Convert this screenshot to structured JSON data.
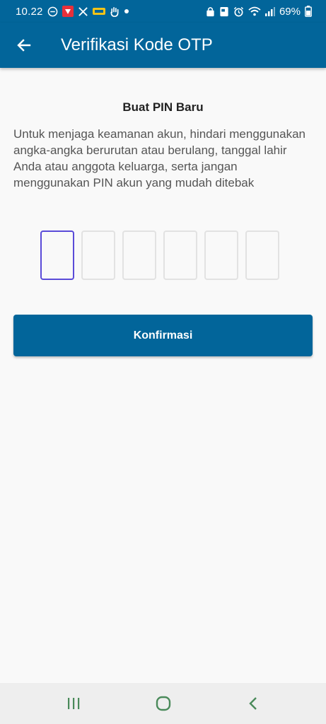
{
  "status_bar": {
    "time": "10.22",
    "battery": "69%",
    "icons": [
      "dnd-icon",
      "app-notification-icon",
      "x-icon",
      "app-icon",
      "hand-icon",
      "dot-icon",
      "lock-icon",
      "photo-icon",
      "alarm-icon",
      "wifi-icon",
      "signal-icon",
      "battery-icon"
    ]
  },
  "app_bar": {
    "title": "Verifikasi Kode OTP",
    "back_icon": "arrow-left-icon"
  },
  "main": {
    "heading": "Buat PIN Baru",
    "description": "Untuk menjaga keamanan akun, hindari menggunakan angka-angka berurutan atau berulang, tanggal lahir Anda atau anggota keluarga, serta jangan menggunakan PIN akun yang mudah ditebak",
    "pin_length": 6,
    "confirm_label": "Konfirmasi"
  },
  "colors": {
    "primary": "#02659a",
    "pin_active_border": "#5a4bd8",
    "pin_border": "#e2e2e2",
    "background": "#f9f9f9"
  },
  "nav_bar": {
    "icons": [
      "recent-apps-icon",
      "home-icon",
      "back-icon"
    ]
  }
}
